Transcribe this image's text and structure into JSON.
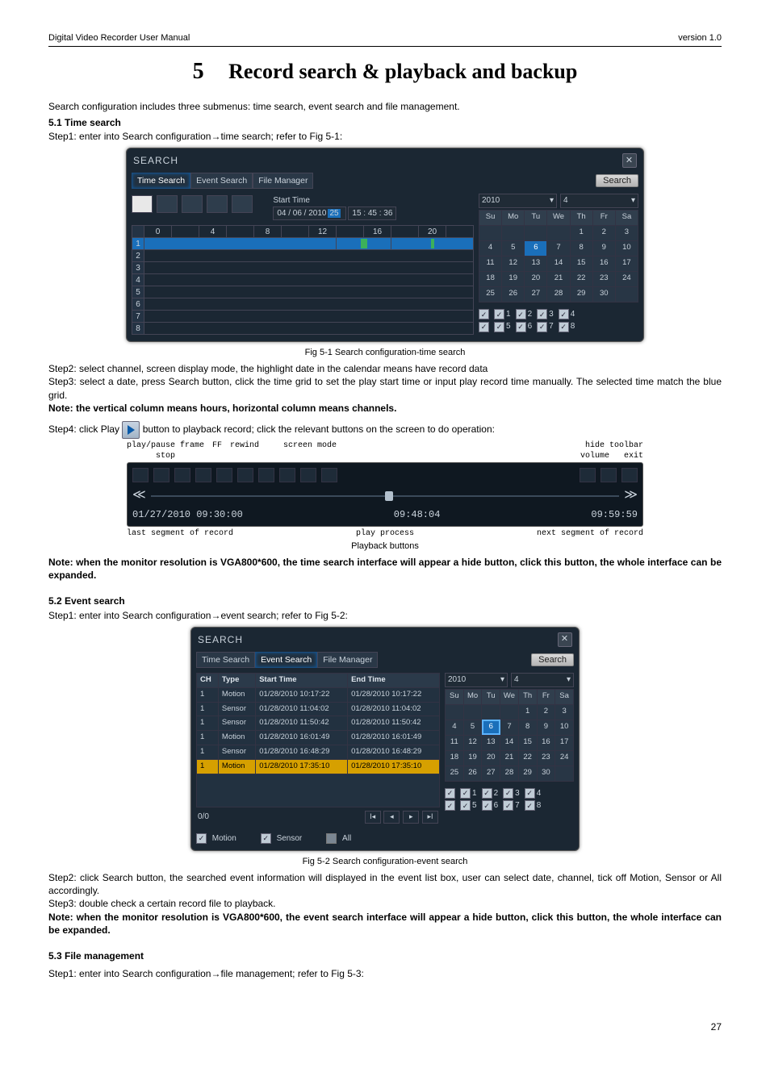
{
  "header": {
    "left": "Digital Video Recorder User Manual",
    "right": "version 1.0"
  },
  "chapter": {
    "num": "5",
    "title": "Record search & playback and backup"
  },
  "intro": "Search configuration includes three submenus: time search, event search and file management.",
  "s51": {
    "head": "5.1  Time search",
    "step1": "Step1: enter into Search configuration→time search; refer to Fig 5-1:"
  },
  "fig1": {
    "title": "SEARCH",
    "tabs": [
      "Time Search",
      "Event Search",
      "File Manager"
    ],
    "search_btn": "Search",
    "start_time_label": "Start Time",
    "date_text_pre": "04 / 06 / 2010",
    "date_text_day": "25",
    "time_text": "  15  :  45  :  36",
    "hours": [
      "0",
      "4",
      "8",
      "12",
      "16",
      "20"
    ],
    "rows": [
      "1",
      "2",
      "3",
      "4",
      "5",
      "6",
      "7",
      "8"
    ],
    "year": "2010",
    "month": "4",
    "dow": [
      "Su",
      "Mo",
      "Tu",
      "We",
      "Th",
      "Fr",
      "Sa"
    ],
    "days": [
      [
        "",
        "",
        "",
        "",
        "1",
        "2",
        "3"
      ],
      [
        "4",
        "5",
        "6",
        "7",
        "8",
        "9",
        "10"
      ],
      [
        "11",
        "12",
        "13",
        "14",
        "15",
        "16",
        "17"
      ],
      [
        "18",
        "19",
        "20",
        "21",
        "22",
        "23",
        "24"
      ],
      [
        "25",
        "26",
        "27",
        "28",
        "29",
        "30",
        ""
      ]
    ],
    "hl_day_r": 1,
    "hl_day_c": 2,
    "channels_row1": [
      "",
      "1",
      "2",
      "3",
      "4"
    ],
    "channels_row2": [
      "",
      "5",
      "6",
      "7",
      "8"
    ],
    "caption": "Fig 5-1 Search configuration-time search"
  },
  "after_fig1": {
    "step2": "Step2: select channel, screen display mode, the highlight date in the calendar means have record data",
    "step3": "Step3: select a date, press Search button, click the time grid to set the play start time or input play record time manually. The selected time match the blue grid.",
    "note": "Note: the vertical column means hours, horizontal column means channels.",
    "step4a": "Step4: click Play ",
    "step4b": " button to playback record; click the relevant buttons on the screen to do operation:"
  },
  "pb": {
    "top_labels_left": [
      "play/pause frame",
      "stop",
      "FF",
      "rewind",
      "screen mode"
    ],
    "top_labels_right": [
      "hide toolbar",
      "volume",
      "exit"
    ],
    "t_left": "01/27/2010 09:30:00",
    "t_mid": "09:48:04",
    "t_right": "09:59:59",
    "b_left": "last segment of record",
    "b_mid": "play process",
    "b_right": "next segment of record",
    "caption": "Playback buttons"
  },
  "note1": "Note: when the monitor resolution is VGA800*600, the time search interface will appear a hide button, click this button, the whole interface can be expanded.",
  "s52": {
    "head": "5.2  Event search",
    "step1": "Step1: enter into Search configuration→event search; refer to Fig 5-2:"
  },
  "fig2": {
    "title": "SEARCH",
    "tabs": [
      "Time Search",
      "Event Search",
      "File Manager"
    ],
    "search_btn": "Search",
    "cols": [
      "CH",
      "Type",
      "Start Time",
      "End Time"
    ],
    "rows": [
      {
        "ch": "1",
        "type": "Motion",
        "st": "01/28/2010 10:17:22",
        "et": "01/28/2010 10:17:22"
      },
      {
        "ch": "1",
        "type": "Sensor",
        "st": "01/28/2010 11:04:02",
        "et": "01/28/2010 11:04:02"
      },
      {
        "ch": "1",
        "type": "Sensor",
        "st": "01/28/2010 11:50:42",
        "et": "01/28/2010 11:50:42"
      },
      {
        "ch": "1",
        "type": "Motion",
        "st": "01/28/2010 16:01:49",
        "et": "01/28/2010 16:01:49"
      },
      {
        "ch": "1",
        "type": "Sensor",
        "st": "01/28/2010 16:48:29",
        "et": "01/28/2010 16:48:29"
      },
      {
        "ch": "1",
        "type": "Motion",
        "st": "01/28/2010 17:35:10",
        "et": "01/28/2010 17:35:10"
      }
    ],
    "pager": "0/0",
    "filters": {
      "motion": "Motion",
      "sensor": "Sensor",
      "all": "All"
    },
    "year": "2010",
    "month": "4",
    "dow": [
      "Su",
      "Mo",
      "Tu",
      "We",
      "Th",
      "Fr",
      "Sa"
    ],
    "days": [
      [
        "",
        "",
        "",
        "",
        "1",
        "2",
        "3"
      ],
      [
        "4",
        "5",
        "6",
        "7",
        "8",
        "9",
        "10"
      ],
      [
        "11",
        "12",
        "13",
        "14",
        "15",
        "16",
        "17"
      ],
      [
        "18",
        "19",
        "20",
        "21",
        "22",
        "23",
        "24"
      ],
      [
        "25",
        "26",
        "27",
        "28",
        "29",
        "30",
        ""
      ]
    ],
    "channels_row1": [
      "",
      "1",
      "2",
      "3",
      "4"
    ],
    "channels_row2": [
      "",
      "5",
      "6",
      "7",
      "8"
    ],
    "caption": "Fig 5-2 Search configuration-event search"
  },
  "after_fig2": {
    "step2": "Step2: click Search button, the searched event information will displayed in the event list box, user can select date, channel, tick off Motion, Sensor or All accordingly.",
    "step3": "Step3: double check a certain record file to playback.",
    "note": "Note: when the monitor resolution is VGA800*600, the event search interface will appear a hide button, click this button, the whole interface can be expanded."
  },
  "s53": {
    "head": "5.3  File management",
    "step1": "Step1: enter into Search configuration→file management; refer to Fig 5-3:"
  },
  "page_num": "27"
}
